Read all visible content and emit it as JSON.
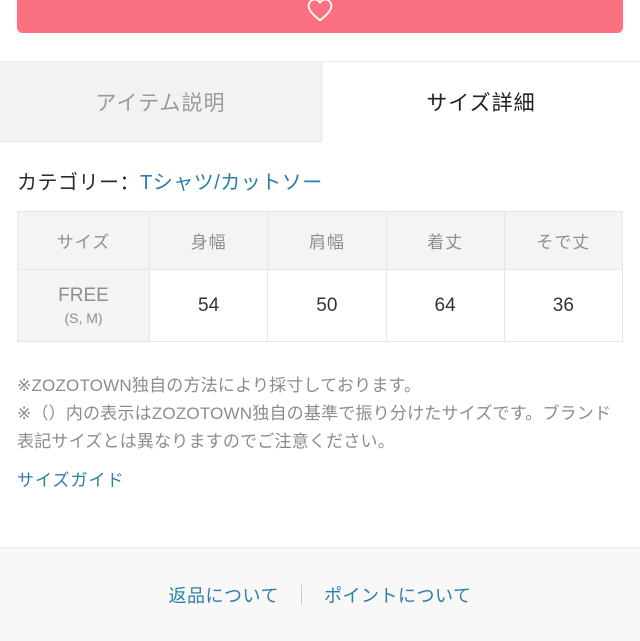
{
  "favorite_button": {
    "icon": "heart-outline-icon",
    "color": "#fa7181"
  },
  "tabs": [
    {
      "label": "アイテム説明",
      "active": false
    },
    {
      "label": "サイズ詳細",
      "active": true
    }
  ],
  "category": {
    "label": "カテゴリー：",
    "link_text": "Tシャツ/カットソー",
    "link_color": "#2a7fa8"
  },
  "size_table": {
    "headers": [
      "サイズ",
      "身幅",
      "肩幅",
      "着丈",
      "そで丈"
    ],
    "rows": [
      {
        "size_main": "FREE",
        "size_sub": "(S, M)",
        "values": [
          "54",
          "50",
          "64",
          "36"
        ]
      }
    ]
  },
  "notes": [
    "※ZOZOTOWN独自の方法により採寸しております。",
    "※（）内の表示はZOZOTOWN独自の基準で振り分けたサイズです。ブランド表記サイズとは異なりますのでご注意ください。"
  ],
  "size_guide_link": "サイズガイド",
  "footer": {
    "links": [
      "返品について",
      "ポイントについて"
    ]
  }
}
